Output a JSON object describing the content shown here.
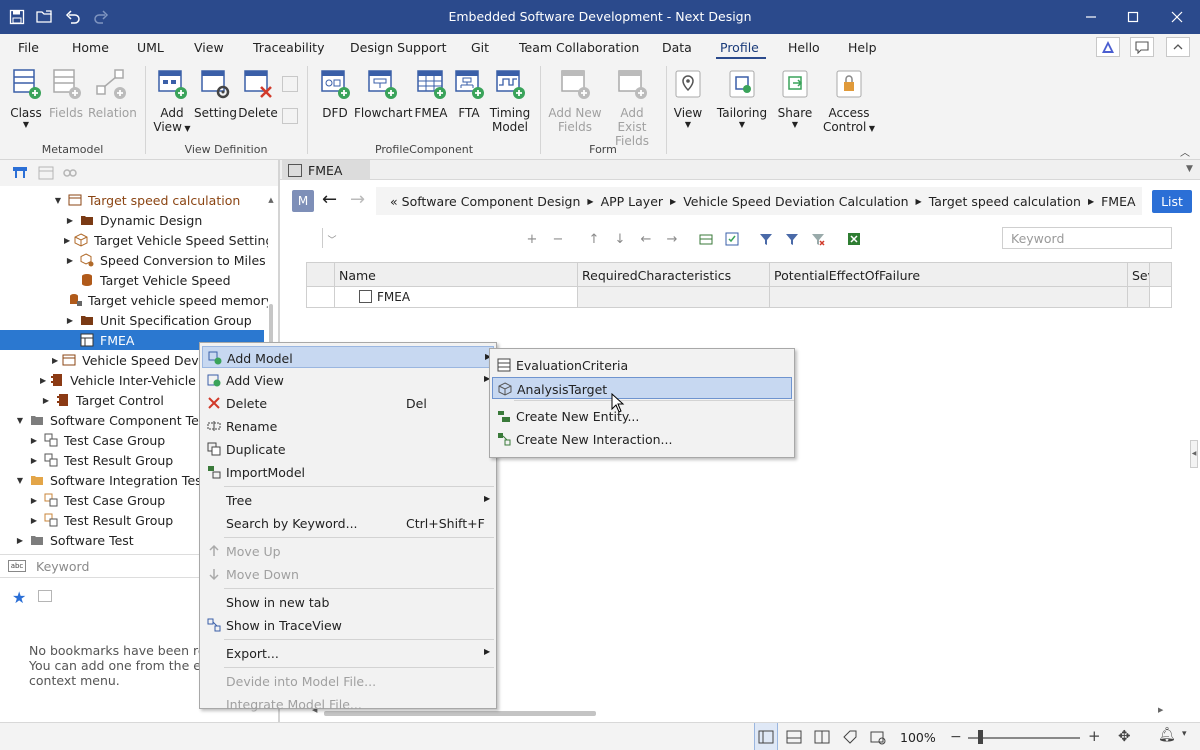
{
  "window": {
    "title": "Embedded Software Development - Next Design"
  },
  "menu": {
    "items": [
      "File",
      "Home",
      "UML",
      "View",
      "Traceability",
      "Design Support",
      "Git",
      "Team Collaboration",
      "Data",
      "Profile",
      "Hello",
      "Help"
    ],
    "active": "Profile"
  },
  "ribbon": {
    "groups": [
      {
        "label": "Metamodel",
        "buttons": [
          {
            "label": "Class",
            "label2": "",
            "icon": "class-icon",
            "enabled": true,
            "dropdown": true
          },
          {
            "label": "Fields",
            "label2": "",
            "icon": "fields-icon",
            "enabled": false,
            "dropdown": false
          },
          {
            "label": "Relation",
            "label2": "",
            "icon": "relation-icon",
            "enabled": false,
            "dropdown": false
          }
        ]
      },
      {
        "label": "View Definition",
        "buttons": [
          {
            "label": "Add",
            "label2": "View",
            "icon": "add-view-icon",
            "enabled": true,
            "dropdown": true
          },
          {
            "label": "Setting",
            "label2": "",
            "icon": "setting-icon",
            "enabled": true,
            "dropdown": false
          },
          {
            "label": "Delete",
            "label2": "",
            "icon": "delete-view-icon",
            "enabled": true,
            "dropdown": false
          }
        ]
      },
      {
        "label": "ProfileComponent",
        "buttons": [
          {
            "label": "DFD",
            "label2": "",
            "icon": "dfd-icon",
            "enabled": true,
            "dropdown": false
          },
          {
            "label": "Flowchart",
            "label2": "",
            "icon": "flowchart-icon",
            "enabled": true,
            "dropdown": false
          },
          {
            "label": "FMEA",
            "label2": "",
            "icon": "fmea-icon",
            "enabled": true,
            "dropdown": false
          },
          {
            "label": "FTA",
            "label2": "",
            "icon": "fta-icon",
            "enabled": true,
            "dropdown": false
          },
          {
            "label": "Timing",
            "label2": "Model",
            "icon": "timing-model-icon",
            "enabled": true,
            "dropdown": false
          }
        ]
      },
      {
        "label": "Form",
        "buttons": [
          {
            "label": "Add New",
            "label2": "Fields",
            "icon": "add-new-fields-icon",
            "enabled": false,
            "dropdown": false
          },
          {
            "label": "Add Exist",
            "label2": "Fields",
            "icon": "add-exist-fields-icon",
            "enabled": false,
            "dropdown": false
          }
        ]
      },
      {
        "label": "",
        "buttons": [
          {
            "label": "View",
            "label2": "",
            "icon": "view-icon",
            "enabled": true,
            "dropdown": true
          },
          {
            "label": "Tailoring",
            "label2": "",
            "icon": "tailoring-icon",
            "enabled": true,
            "dropdown": true
          },
          {
            "label": "Share",
            "label2": "",
            "icon": "share-icon",
            "enabled": true,
            "dropdown": true
          },
          {
            "label": "Access",
            "label2": "Control",
            "icon": "access-control-icon",
            "enabled": true,
            "dropdown": true
          }
        ]
      }
    ]
  },
  "tree": {
    "items": [
      {
        "label": "Target speed calculation",
        "depth": 3,
        "arrow": "down",
        "icon": "folder-outline",
        "style": "brown"
      },
      {
        "label": "Dynamic Design",
        "depth": 4,
        "arrow": "right",
        "icon": "folder-brown",
        "style": ""
      },
      {
        "label": "Target Vehicle Speed Setting",
        "depth": 4,
        "arrow": "right",
        "icon": "cube",
        "style": ""
      },
      {
        "label": "Speed Conversion to Miles",
        "depth": 4,
        "arrow": "right",
        "icon": "cube-gear",
        "style": ""
      },
      {
        "label": "Target Vehicle Speed",
        "depth": 4,
        "arrow": "",
        "icon": "cylinder",
        "style": ""
      },
      {
        "label": "Target vehicle speed memory",
        "depth": 4,
        "arrow": "",
        "icon": "cylinder-lock",
        "style": ""
      },
      {
        "label": "Unit Specification Group",
        "depth": 4,
        "arrow": "right",
        "icon": "folder-brown",
        "style": ""
      },
      {
        "label": "FMEA",
        "depth": 4,
        "arrow": "",
        "icon": "fmea",
        "style": "sel"
      },
      {
        "label": "Vehicle Speed Deviation Calculation",
        "depth": 3,
        "arrow": "right",
        "icon": "folder-outline",
        "style": ""
      },
      {
        "label": "Vehicle Inter-Vehicle Distance Control",
        "depth": 2,
        "arrow": "right",
        "icon": "component",
        "style": ""
      },
      {
        "label": "Target Control",
        "depth": 2,
        "arrow": "right",
        "icon": "component",
        "style": ""
      },
      {
        "label": "Software Component Test",
        "depth": 0,
        "arrow": "down",
        "icon": "folder-gray",
        "style": ""
      },
      {
        "label": "Test Case Group",
        "depth": 1,
        "arrow": "right",
        "icon": "group",
        "style": ""
      },
      {
        "label": "Test Result Group",
        "depth": 1,
        "arrow": "right",
        "icon": "group",
        "style": ""
      },
      {
        "label": "Software Integration Test",
        "depth": 0,
        "arrow": "down",
        "icon": "folder-orange",
        "style": ""
      },
      {
        "label": "Test Case Group",
        "depth": 1,
        "arrow": "right",
        "icon": "group-orange",
        "style": ""
      },
      {
        "label": "Test Result Group",
        "depth": 1,
        "arrow": "right",
        "icon": "group-orange",
        "style": ""
      },
      {
        "label": "Software Test",
        "depth": 0,
        "arrow": "right",
        "icon": "folder-gray",
        "style": ""
      }
    ]
  },
  "left_search": {
    "placeholder": "Keyword"
  },
  "bookmarks": {
    "line1": "No bookmarks have been registered.",
    "line2": "You can add one from the editor's",
    "line3": "context menu."
  },
  "editor": {
    "tab_label": "FMEA",
    "badge": "M",
    "breadcrumb": [
      "Software Component Design",
      "APP Layer",
      "Vehicle Speed Deviation Calculation",
      "Target speed calculation",
      "FMEA"
    ],
    "breadcrumb_lead": "«",
    "list_button": "List",
    "keyword_placeholder": "Keyword",
    "columns": [
      "Name",
      "RequiredCharacteristics",
      "PotentialEffectOfFailure",
      "Severity"
    ],
    "row_name": "FMEA"
  },
  "context_menu": {
    "items": [
      {
        "label": "Add Model",
        "shortcut": "",
        "sub": true,
        "icon": "add-model-icon",
        "enabled": true,
        "highlight": true
      },
      {
        "label": "Add View",
        "shortcut": "",
        "sub": true,
        "icon": "add-view-icon",
        "enabled": true,
        "highlight": false
      },
      {
        "label": "Delete",
        "shortcut": "Del",
        "sub": false,
        "icon": "delete-icon",
        "enabled": true,
        "highlight": false
      },
      {
        "label": "Rename",
        "shortcut": "",
        "sub": false,
        "icon": "rename-icon",
        "enabled": true,
        "highlight": false
      },
      {
        "label": "Duplicate",
        "shortcut": "",
        "sub": false,
        "icon": "duplicate-icon",
        "enabled": true,
        "highlight": false
      },
      {
        "label": "ImportModel",
        "shortcut": "",
        "sub": false,
        "icon": "import-model-icon",
        "enabled": true,
        "highlight": false
      },
      {
        "sep": true
      },
      {
        "label": "Tree",
        "shortcut": "",
        "sub": true,
        "icon": "",
        "enabled": true,
        "highlight": false
      },
      {
        "label": "Search by Keyword...",
        "shortcut": "Ctrl+Shift+F",
        "sub": false,
        "icon": "",
        "enabled": true,
        "highlight": false
      },
      {
        "sep": true
      },
      {
        "label": "Move Up",
        "shortcut": "",
        "sub": false,
        "icon": "move-up-icon",
        "enabled": false,
        "highlight": false
      },
      {
        "label": "Move Down",
        "shortcut": "",
        "sub": false,
        "icon": "move-down-icon",
        "enabled": false,
        "highlight": false
      },
      {
        "sep": true
      },
      {
        "label": "Show in new tab",
        "shortcut": "",
        "sub": false,
        "icon": "",
        "enabled": true,
        "highlight": false
      },
      {
        "label": "Show in TraceView",
        "shortcut": "",
        "sub": false,
        "icon": "trace-view-icon",
        "enabled": true,
        "highlight": false
      },
      {
        "sep": true
      },
      {
        "label": "Export...",
        "shortcut": "",
        "sub": true,
        "icon": "",
        "enabled": true,
        "highlight": false
      },
      {
        "sep": true
      },
      {
        "label": "Devide into Model File...",
        "shortcut": "",
        "sub": false,
        "icon": "",
        "enabled": false,
        "highlight": false
      },
      {
        "label": "Integrate Model File...",
        "shortcut": "",
        "sub": false,
        "icon": "",
        "enabled": false,
        "highlight": false
      }
    ]
  },
  "submenu": {
    "items": [
      {
        "label": "EvaluationCriteria",
        "icon": "evaluation-criteria-icon",
        "highlight": false
      },
      {
        "label": "AnalysisTarget",
        "icon": "analysis-target-icon",
        "highlight": true
      },
      {
        "sep": true
      },
      {
        "label": "Create New Entity...",
        "icon": "create-entity-icon",
        "highlight": false
      },
      {
        "label": "Create New Interaction...",
        "icon": "create-interaction-icon",
        "highlight": false
      }
    ]
  },
  "status": {
    "zoom": "100%"
  },
  "colors": {
    "titlebar": "#2b4a8c",
    "accent": "#2b6fd6",
    "selection": "#2b78d0",
    "menu_highlight": "#c7d8f1"
  }
}
